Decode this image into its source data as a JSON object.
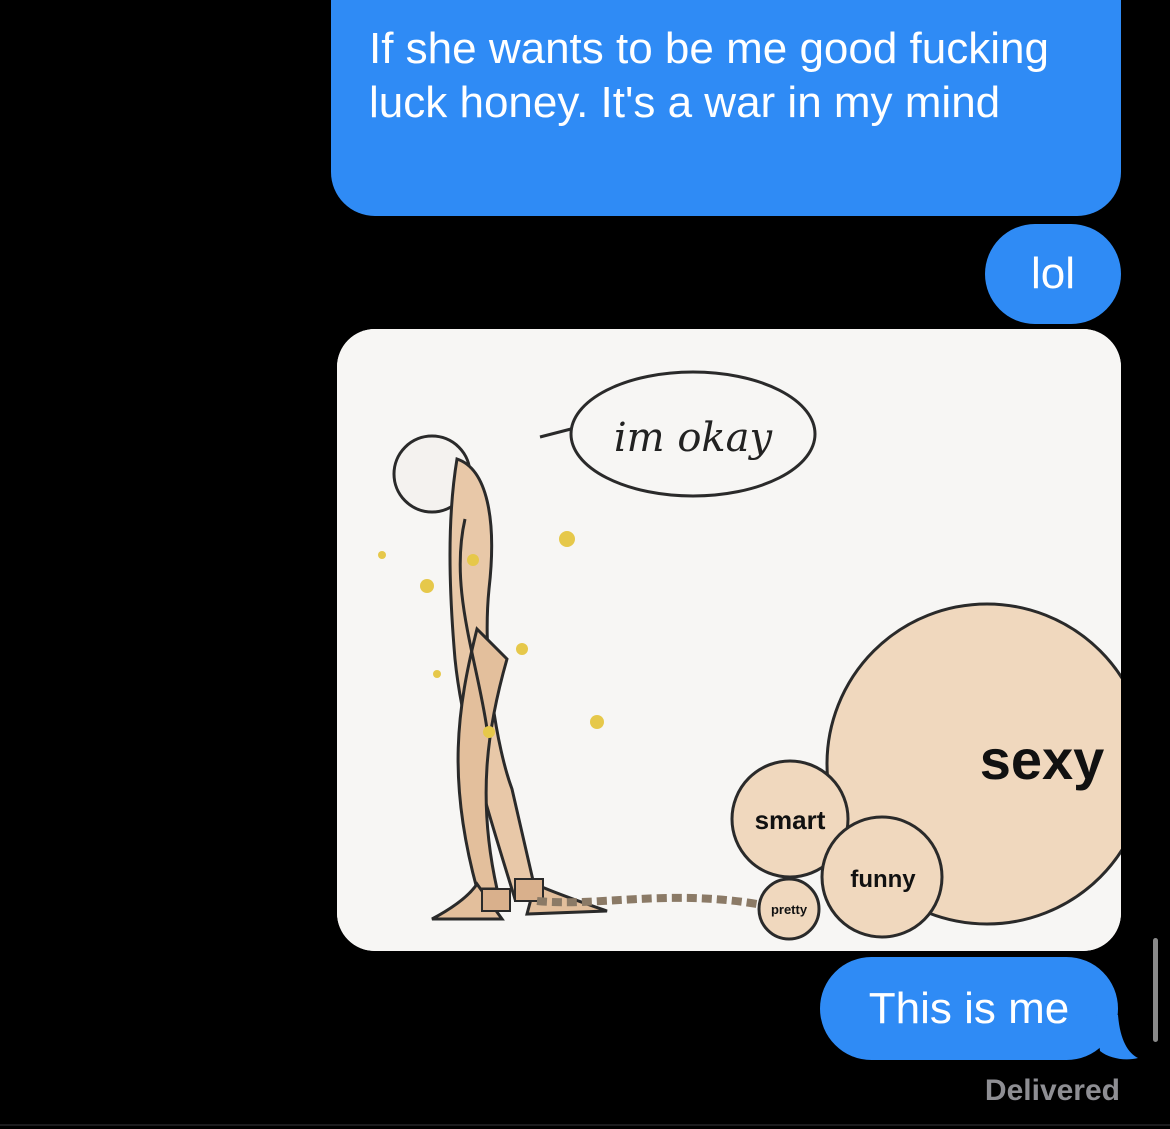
{
  "messages": [
    {
      "sender": "me",
      "type": "text",
      "text": "If she wants to be me good fucking luck honey. It's a war in my mind"
    },
    {
      "sender": "me",
      "type": "text",
      "text": "lol"
    },
    {
      "sender": "me",
      "type": "image",
      "image": {
        "labels": {
          "speech": "im okay",
          "big": "sexy",
          "medium": "smart",
          "small": "funny",
          "tiny": "pretty"
        }
      }
    },
    {
      "sender": "me",
      "type": "text",
      "text": "This is me"
    }
  ],
  "status": "Delivered",
  "colors": {
    "bubble": "#2f8bf5",
    "background": "#000000",
    "status": "#8e8e93"
  }
}
